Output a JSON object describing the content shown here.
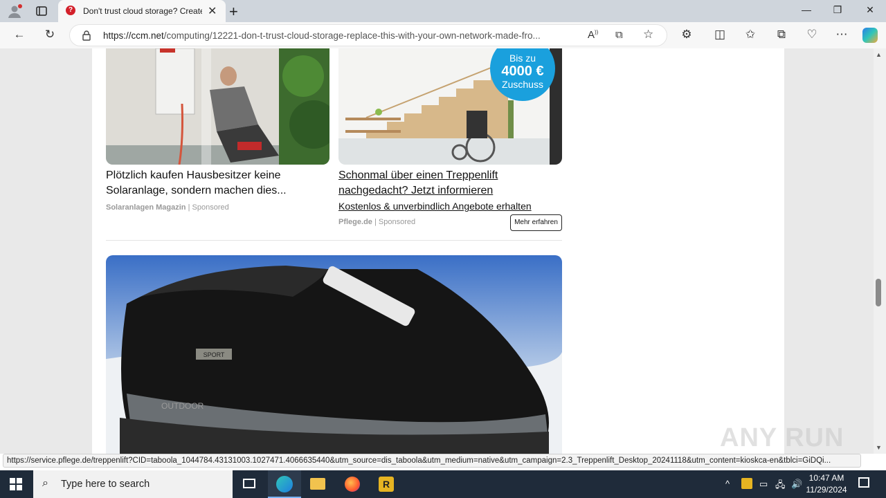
{
  "browser": {
    "tab_title": "Don't trust cloud storage? Create",
    "url_host": "https://ccm.net",
    "url_path": "/computing/12221-don-t-trust-cloud-storage-replace-this-with-your-own-network-made-fro..."
  },
  "ads": [
    {
      "title": "Plötzlich kaufen Hausbesitzer keine Solaranlage, sondern machen dies...",
      "source": "Solaranlagen Magazin",
      "sponsored": "Sponsored"
    },
    {
      "title": "Schonmal über einen Treppenlift nachgedacht? Jetzt informieren",
      "description": "Kostenlos & unverbindlich Angebote erhalten",
      "source": "Pflege.de",
      "sponsored": "Sponsored",
      "cta": "Mehr erfahren",
      "badge_line1": "Bis zu",
      "badge_line2": "4000 €",
      "badge_line3": "Zuschuss"
    }
  ],
  "shoe_ad": {
    "tag_text": "SPORT",
    "sole_text": "OUTDOOR"
  },
  "status_url": "https://service.pflege.de/treppenlift?CID=taboola_1044784.43131003.1027471.4066635440&utm_source=dis_taboola&utm_medium=native&utm_campaign=2.3_Treppenlift_Desktop_20241118&utm_content=kioskca-en&tblci=GiDQi...",
  "taskbar": {
    "search_placeholder": "Type here to search",
    "time": "10:47 AM",
    "date": "11/29/2024"
  },
  "watermark": "ANY RUN"
}
